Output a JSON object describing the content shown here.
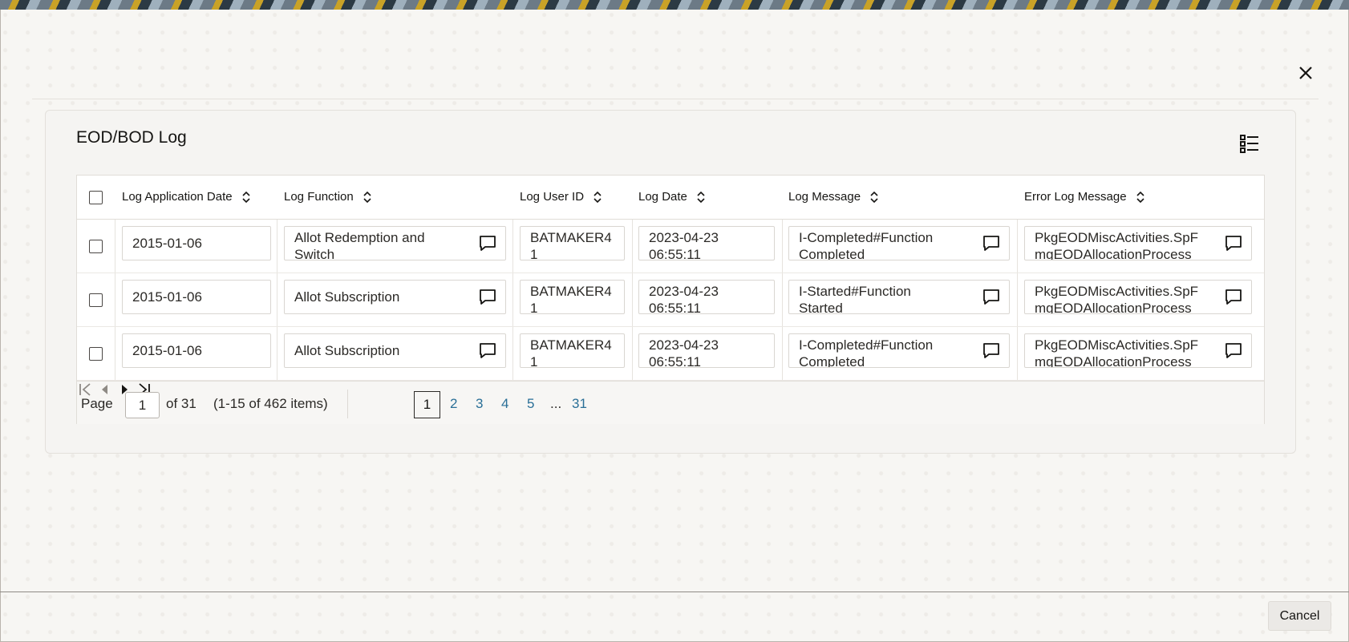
{
  "dialog": {
    "title": "EOD/BOD Log",
    "cancel_label": "Cancel"
  },
  "table": {
    "columns": [
      {
        "label": "Log Application Date"
      },
      {
        "label": "Log Function"
      },
      {
        "label": "Log User ID"
      },
      {
        "label": "Log Date"
      },
      {
        "label": "Log Message"
      },
      {
        "label": "Error Log Message"
      }
    ],
    "rows": [
      {
        "app_date": "2015-01-06",
        "function": "Allot Redemption and\nSwitch",
        "user_id": "BATMAKER4\n1",
        "log_date": "2023-04-23\n06:55:11",
        "message": "I-Completed#Function\nCompleted",
        "error_message": "PkgEODMiscActivities.SpF\nmgEODAllocationProcess"
      },
      {
        "app_date": "2015-01-06",
        "function": "Allot Subscription",
        "user_id": "BATMAKER4\n1",
        "log_date": "2023-04-23\n06:55:11",
        "message": "I-Started#Function\nStarted",
        "error_message": "PkgEODMiscActivities.SpF\nmgEODAllocationProcess"
      },
      {
        "app_date": "2015-01-06",
        "function": "Allot Subscription",
        "user_id": "BATMAKER4\n1",
        "log_date": "2023-04-23\n06:55:11",
        "message": "I-Completed#Function\nCompleted",
        "error_message": "PkgEODMiscActivities.SpF\nmgEODAllocationProcess"
      }
    ]
  },
  "pagination": {
    "page_label": "Page",
    "current_page": "1",
    "of_label": "of 31",
    "items_label": "(1-15 of 462 items)",
    "pages": [
      "1",
      "2",
      "3",
      "4",
      "5"
    ],
    "ellipsis": "...",
    "last_page": "31"
  },
  "icons": {
    "close": "close-icon",
    "list_view": "list-icon",
    "sort": "sort-icon",
    "message": "message-icon",
    "first": "first-page-icon",
    "prev": "previous-page-icon",
    "next": "next-page-icon",
    "last": "last-page-icon"
  }
}
